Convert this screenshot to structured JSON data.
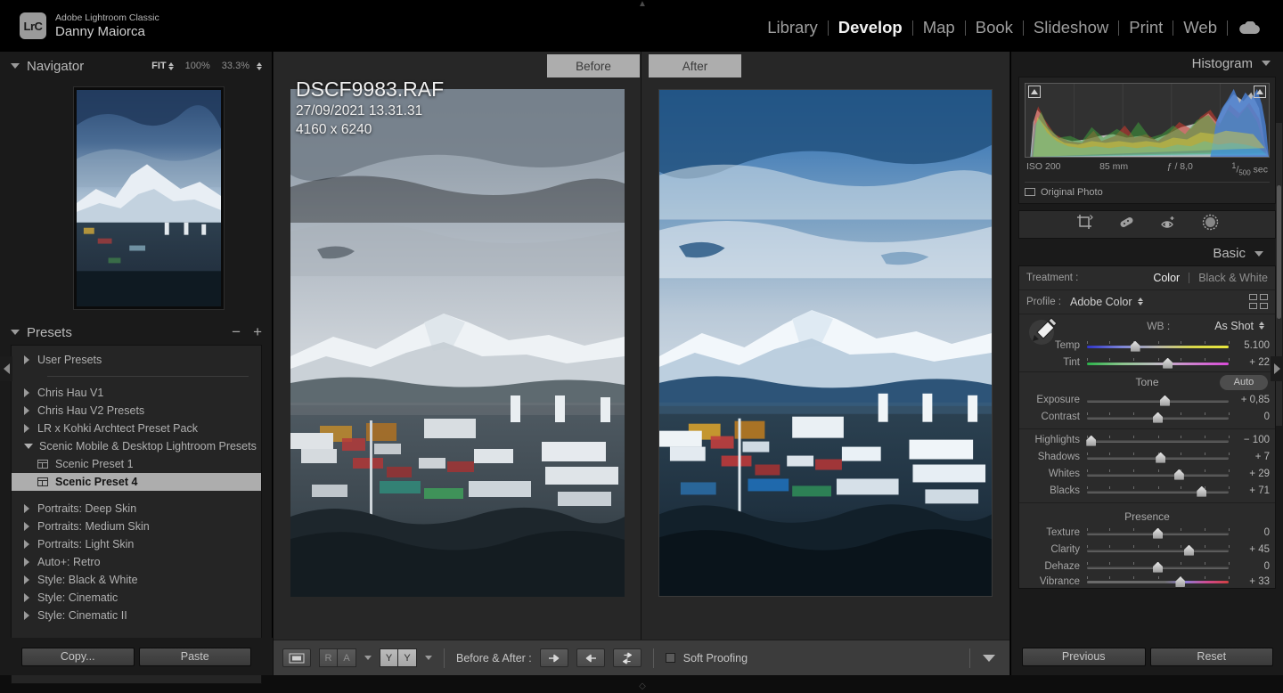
{
  "app": {
    "brand_badge": "LrC",
    "product": "Adobe Lightroom Classic",
    "user": "Danny Maiorca",
    "modules": [
      {
        "label": "Library",
        "active": false
      },
      {
        "label": "Develop",
        "active": true
      },
      {
        "label": "Map",
        "active": false
      },
      {
        "label": "Book",
        "active": false
      },
      {
        "label": "Slideshow",
        "active": false
      },
      {
        "label": "Print",
        "active": false
      },
      {
        "label": "Web",
        "active": false
      }
    ],
    "cloud_icon": "cloud-icon"
  },
  "navigator": {
    "title": "Navigator",
    "fit_label": "FIT",
    "zoom_100": "100%",
    "zoom_custom": "33.3%"
  },
  "presets": {
    "title": "Presets",
    "minus_label": "−",
    "plus_label": "+",
    "items": [
      {
        "label": "User Presets",
        "type": "group",
        "expanded": false,
        "selected": false
      },
      {
        "label": "",
        "type": "divider"
      },
      {
        "label": "Chris Hau V1",
        "type": "group",
        "expanded": false,
        "selected": false
      },
      {
        "label": "Chris Hau V2 Presets",
        "type": "group",
        "expanded": false,
        "selected": false
      },
      {
        "label": "LR x Kohki Archtect Preset Pack",
        "type": "group",
        "expanded": false,
        "selected": false
      },
      {
        "label": "Scenic Mobile & Desktop Lightroom Presets",
        "type": "group",
        "expanded": true,
        "selected": false
      },
      {
        "label": "Scenic Preset 1",
        "type": "preset",
        "selected": false
      },
      {
        "label": "Scenic Preset 4",
        "type": "preset",
        "selected": true
      },
      {
        "label": "",
        "type": "gap"
      },
      {
        "label": "Portraits: Deep Skin",
        "type": "group",
        "expanded": false,
        "selected": false
      },
      {
        "label": "Portraits: Medium Skin",
        "type": "group",
        "expanded": false,
        "selected": false
      },
      {
        "label": "Portraits: Light Skin",
        "type": "group",
        "expanded": false,
        "selected": false
      },
      {
        "label": "Auto+: Retro",
        "type": "group",
        "expanded": false,
        "selected": false
      },
      {
        "label": "Style: Black & White",
        "type": "group",
        "expanded": false,
        "selected": false
      },
      {
        "label": "Style: Cinematic",
        "type": "group",
        "expanded": false,
        "selected": false
      },
      {
        "label": "Style: Cinematic II",
        "type": "group",
        "expanded": false,
        "selected": false
      }
    ],
    "copy_label": "Copy...",
    "paste_label": "Paste"
  },
  "viewer": {
    "before_tab": "Before",
    "after_tab": "After",
    "overlay": {
      "filename": "DSCF9983.RAF",
      "capture_time": "27/09/2021 13.31.31",
      "dimensions": "4160 x 6240"
    }
  },
  "toolbar": {
    "view_mode_icon": "loupe-view-icon",
    "flag_r": "R",
    "flag_a": "A",
    "flag_y1": "Y",
    "flag_y2": "Y",
    "before_after_label": "Before & After :",
    "copy_after_to_before_icon": "arrow-right-icon",
    "copy_before_to_after_icon": "arrow-left-icon",
    "swap_icon": "swap-before-after-icon",
    "soft_proofing_label": "Soft Proofing",
    "soft_proofing_checked": false,
    "toolbar_menu_icon": "chevron-down-icon"
  },
  "histogram": {
    "title": "Histogram",
    "shadow_clipping_icon": "shadow-clipping-icon",
    "highlight_clipping_icon": "highlight-clipping-icon",
    "iso": "ISO 200",
    "focal_length": "85 mm",
    "aperture": "ƒ / 8,0",
    "shutter_numerator": "1",
    "shutter_denominator": "500",
    "shutter_unit": "sec",
    "original_photo_label": "Original Photo"
  },
  "tools": [
    {
      "name": "crop-overlay-icon"
    },
    {
      "name": "spot-removal-icon"
    },
    {
      "name": "red-eye-correction-icon"
    },
    {
      "name": "masking-icon"
    }
  ],
  "basic": {
    "title": "Basic",
    "treatment_label": "Treatment :",
    "treatment_options": [
      {
        "label": "Color",
        "active": true
      },
      {
        "label": "Black & White",
        "active": false
      }
    ],
    "profile_label": "Profile :",
    "profile_value": "Adobe Color",
    "profile_browser_icon": "profile-grid-icon",
    "wb_label": "WB :",
    "wb_value": "As Shot",
    "eyedropper_icon": "white-balance-selector-icon",
    "wb_sliders": [
      {
        "name": "Temp",
        "value": "5.100",
        "pos": 34,
        "gradient": "temp"
      },
      {
        "name": "Tint",
        "value": "+ 22",
        "pos": 57,
        "gradient": "tint"
      }
    ],
    "tone_title": "Tone",
    "auto_label": "Auto",
    "tone_sliders": [
      {
        "name": "Exposure",
        "value": "+ 0,85",
        "pos": 55
      },
      {
        "name": "Contrast",
        "value": "0",
        "pos": 50
      }
    ],
    "tone_sliders2": [
      {
        "name": "Highlights",
        "value": "− 100",
        "pos": 3
      },
      {
        "name": "Shadows",
        "value": "+ 7",
        "pos": 52
      },
      {
        "name": "Whites",
        "value": "+ 29",
        "pos": 65
      },
      {
        "name": "Blacks",
        "value": "+ 71",
        "pos": 81
      }
    ],
    "presence_title": "Presence",
    "presence_sliders": [
      {
        "name": "Texture",
        "value": "0",
        "pos": 50
      },
      {
        "name": "Clarity",
        "value": "+ 45",
        "pos": 72
      },
      {
        "name": "Dehaze",
        "value": "0",
        "pos": 50
      }
    ],
    "presence_sliders2": [
      {
        "name": "Vibrance",
        "value": "+ 33",
        "pos": 66,
        "gradient": "vibrance"
      }
    ]
  },
  "right_footer": {
    "previous_label": "Previous",
    "reset_label": "Reset"
  },
  "colors": {
    "panel_bg": "#1a1a1a",
    "canvas_bg": "#272727",
    "toolbar_bg": "#3c3c3c",
    "selected_preset_bg": "#adadad",
    "text": "#b0b0b0",
    "accent_blue": "#3a6fbf"
  }
}
